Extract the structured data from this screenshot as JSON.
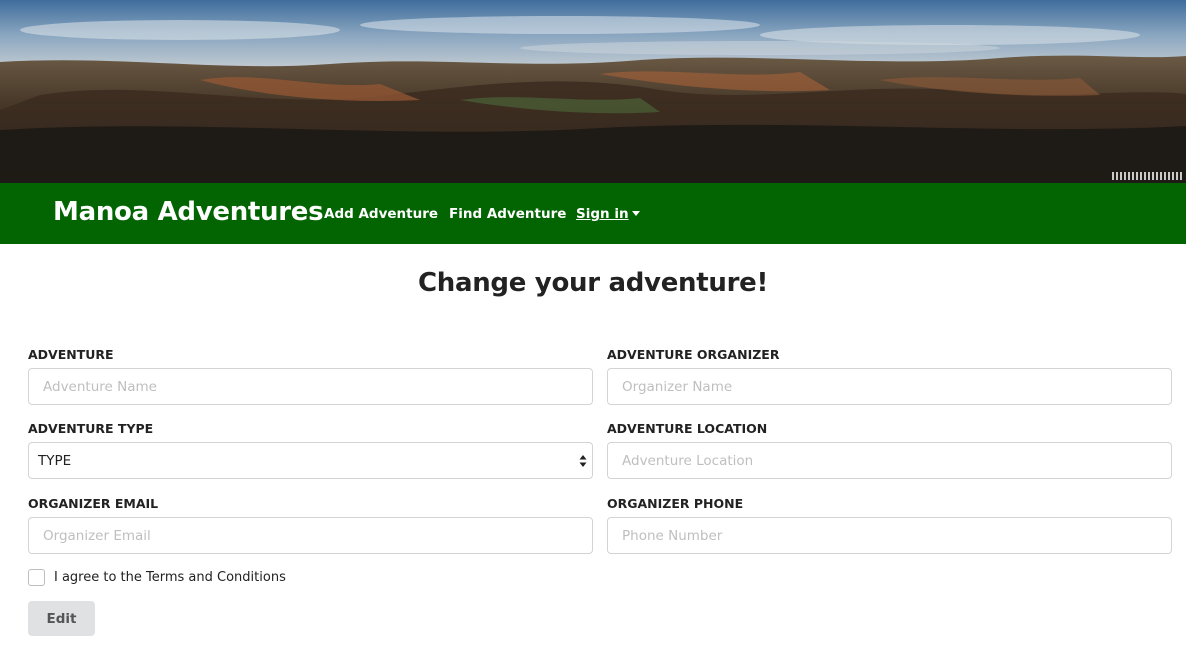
{
  "banner": {
    "image": "mountain-landscape"
  },
  "navbar": {
    "brand": "Manoa Adventures",
    "links": [
      {
        "label": "Add Adventure"
      },
      {
        "label": "Find Adventure"
      },
      {
        "label": "Sign in"
      }
    ],
    "color": "#026502"
  },
  "page": {
    "title": "Change your adventure!"
  },
  "form": {
    "adventure": {
      "label": "ADVENTURE",
      "placeholder": "Adventure Name",
      "value": ""
    },
    "organizer": {
      "label": "ADVENTURE ORGANIZER",
      "placeholder": "Organizer Name",
      "value": ""
    },
    "type": {
      "label": "ADVENTURE TYPE",
      "selected": "TYPE"
    },
    "location": {
      "label": "ADVENTURE LOCATION",
      "placeholder": "Adventure Location",
      "value": ""
    },
    "email": {
      "label": "ORGANIZER EMAIL",
      "placeholder": "Organizer Email",
      "value": ""
    },
    "phone": {
      "label": "ORGANIZER PHONE",
      "placeholder": "Phone Number",
      "value": ""
    },
    "terms": {
      "label": "I agree to the Terms and Conditions",
      "checked": false
    },
    "submit": {
      "label": "Edit"
    }
  }
}
